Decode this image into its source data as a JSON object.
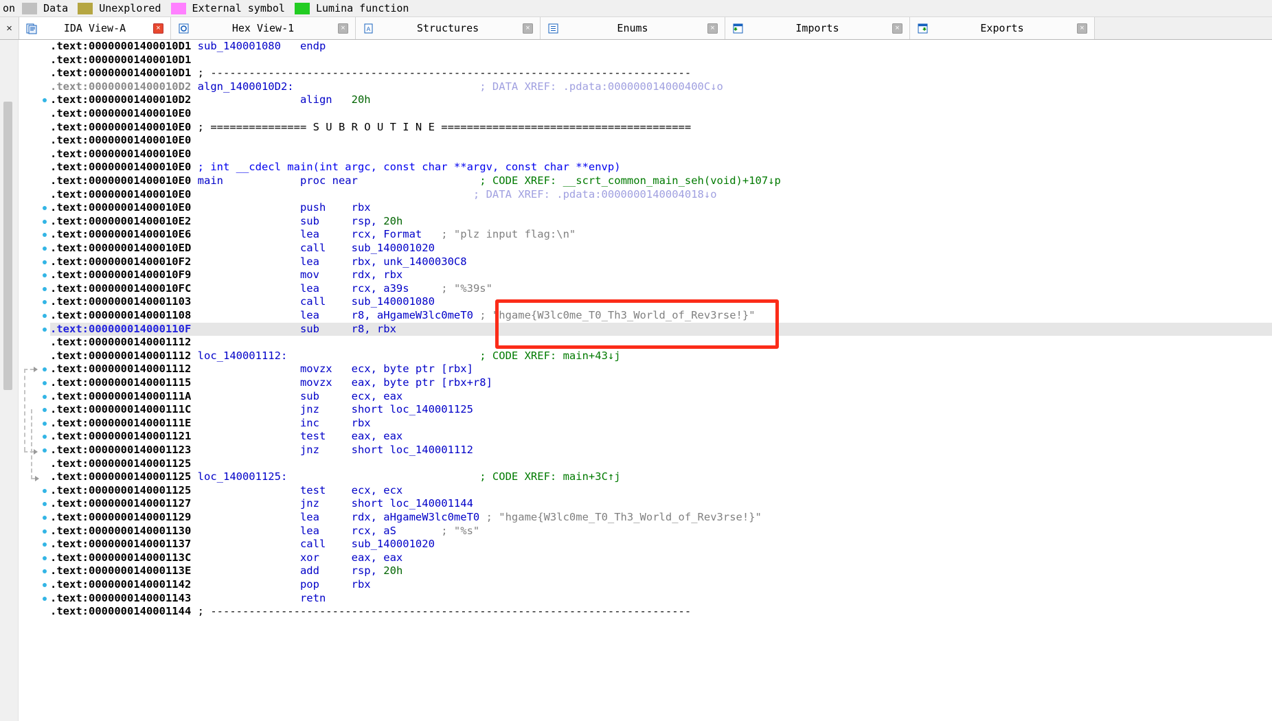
{
  "legend": {
    "leading_text": "on",
    "items": [
      {
        "label": "Data",
        "color": "#c0c0c0"
      },
      {
        "label": "Unexplored",
        "color": "#b5a642"
      },
      {
        "label": "External symbol",
        "color": "#ff80ff"
      },
      {
        "label": "Lumina function",
        "color": "#22cc22"
      }
    ]
  },
  "tabs": {
    "close_all_label": "×",
    "items": [
      {
        "title": "IDA View-A",
        "icon": "ida-view-icon",
        "active": true,
        "close_label": "×"
      },
      {
        "title": "Hex View-1",
        "icon": "hex-view-icon",
        "active": false,
        "close_label": "×"
      },
      {
        "title": "Structures",
        "icon": "structures-icon",
        "active": false,
        "close_label": "×"
      },
      {
        "title": "Enums",
        "icon": "enums-icon",
        "active": false,
        "close_label": "×"
      },
      {
        "title": "Imports",
        "icon": "imports-icon",
        "active": false,
        "close_label": "×"
      },
      {
        "title": "Exports",
        "icon": "exports-icon",
        "active": false,
        "close_label": "×"
      }
    ]
  },
  "annotation": {
    "highlight_color": "#fb2c19",
    "highlighted_string": "\"hgame{W3lc0me_T0_Th3_World_of_Rev3rse!}\""
  },
  "disassembly": {
    "segment": ".text",
    "lines": [
      {
        "addr": ".text:00000001400010D1",
        "label": "sub_140001080",
        "mnem": "",
        "ops": "",
        "kw": "endp",
        "cmt": "",
        "dot": false
      },
      {
        "addr": ".text:00000001400010D1",
        "label": "",
        "mnem": "",
        "ops": "",
        "kw": "",
        "cmt": "",
        "dot": false
      },
      {
        "addr": ".text:00000001400010D1",
        "label": "",
        "mnem": "",
        "ops": "",
        "kw": "",
        "cmt": "",
        "dash": "; ---------------------------------------------------------------------------",
        "dot": false
      },
      {
        "addr": ".text:00000001400010D2",
        "dim": true,
        "label": "algn_1400010D2:",
        "mnem": "",
        "ops": "",
        "kw": "",
        "cmt": "; DATA XREF: .pdata:000000014000400C↓o",
        "cmt_type": "lav",
        "dot": false
      },
      {
        "addr": ".text:00000001400010D2",
        "label": "",
        "mnem": "align",
        "ops": "20h",
        "kw": "",
        "cmt": "",
        "dot": true
      },
      {
        "addr": ".text:00000001400010E0",
        "label": "",
        "mnem": "",
        "ops": "",
        "kw": "",
        "cmt": "",
        "dot": false
      },
      {
        "addr": ".text:00000001400010E0",
        "label": "",
        "mnem": "",
        "ops": "",
        "kw": "",
        "cmt": "",
        "banner": "; =============== S U B R O U T I N E =======================================",
        "dot": false
      },
      {
        "addr": ".text:00000001400010E0",
        "label": "",
        "mnem": "",
        "ops": "",
        "kw": "",
        "cmt": "",
        "dot": false
      },
      {
        "addr": ".text:00000001400010E0",
        "label": "",
        "mnem": "",
        "ops": "",
        "kw": "",
        "cmt": "",
        "dot": false
      },
      {
        "addr": ".text:00000001400010E0",
        "label": "",
        "mnem": "",
        "ops": "",
        "kw": "",
        "cmt": "",
        "bluecmt": "; int __cdecl main(int argc, const char **argv, const char **envp)",
        "dot": false
      },
      {
        "addr": ".text:00000001400010E0",
        "label": "main",
        "mnem": "",
        "ops": "",
        "kw": "proc near",
        "cmt": "; CODE XREF: __scrt_common_main_seh(void)+107↓p",
        "cmt_type": "green",
        "dot": false
      },
      {
        "addr": ".text:00000001400010E0",
        "label": "",
        "mnem": "",
        "ops": "",
        "kw": "",
        "cmt": "; DATA XREF: .pdata:0000000140004018↓o",
        "cmt_type": "lav",
        "dot": false
      },
      {
        "addr": ".text:00000001400010E0",
        "label": "",
        "mnem": "push",
        "ops": "rbx",
        "kw": "",
        "cmt": "",
        "dot": true
      },
      {
        "addr": ".text:00000001400010E2",
        "label": "",
        "mnem": "sub",
        "ops": "rsp, 20h",
        "kw": "",
        "cmt": "",
        "dot": true
      },
      {
        "addr": ".text:00000001400010E6",
        "label": "",
        "mnem": "lea",
        "ops": "rcx, Format",
        "kw": "",
        "cmt": "; \"plz input flag:\\n\"",
        "cmt_type": "gray",
        "dot": true
      },
      {
        "addr": ".text:00000001400010ED",
        "label": "",
        "mnem": "call",
        "ops": "sub_140001020",
        "kw": "",
        "cmt": "",
        "dot": true
      },
      {
        "addr": ".text:00000001400010F2",
        "label": "",
        "mnem": "lea",
        "ops": "rbx, unk_1400030C8",
        "kw": "",
        "cmt": "",
        "dot": true
      },
      {
        "addr": ".text:00000001400010F9",
        "label": "",
        "mnem": "mov",
        "ops": "rdx, rbx",
        "kw": "",
        "cmt": "",
        "dot": true
      },
      {
        "addr": ".text:00000001400010FC",
        "label": "",
        "mnem": "lea",
        "ops": "rcx, a39s",
        "kw": "",
        "cmt": "; \"%39s\"",
        "cmt_type": "gray",
        "dot": true
      },
      {
        "addr": ".text:0000000140001103",
        "label": "",
        "mnem": "call",
        "ops": "sub_140001080",
        "kw": "",
        "cmt": "",
        "dot": true
      },
      {
        "addr": ".text:0000000140001108",
        "label": "",
        "mnem": "lea",
        "ops": "r8, aHgameW3lc0meT0",
        "kw": "",
        "cmt": "; \"hgame{W3lc0me_T0_Th3_World_of_Rev3rse!}\"",
        "cmt_type": "gray",
        "dot": true
      },
      {
        "addr": ".text:000000014000110F",
        "label": "",
        "mnem": "sub",
        "ops": "r8, rbx",
        "kw": "",
        "cmt": "",
        "dot": true,
        "selected": true
      },
      {
        "addr": ".text:0000000140001112",
        "label": "",
        "mnem": "",
        "ops": "",
        "kw": "",
        "cmt": "",
        "dot": false
      },
      {
        "addr": ".text:0000000140001112",
        "label": "loc_140001112:",
        "mnem": "",
        "ops": "",
        "kw": "",
        "cmt": "; CODE XREF: main+43↓j",
        "cmt_type": "green",
        "dot": false
      },
      {
        "addr": ".text:0000000140001112",
        "label": "",
        "mnem": "movzx",
        "ops": "ecx, byte ptr [rbx]",
        "kw": "",
        "cmt": "",
        "dot": true
      },
      {
        "addr": ".text:0000000140001115",
        "label": "",
        "mnem": "movzx",
        "ops": "eax, byte ptr [rbx+r8]",
        "kw": "",
        "cmt": "",
        "dot": true
      },
      {
        "addr": ".text:000000014000111A",
        "label": "",
        "mnem": "sub",
        "ops": "ecx, eax",
        "kw": "",
        "cmt": "",
        "dot": true
      },
      {
        "addr": ".text:000000014000111C",
        "label": "",
        "mnem": "jnz",
        "ops": "short loc_140001125",
        "kw": "",
        "cmt": "",
        "dot": true
      },
      {
        "addr": ".text:000000014000111E",
        "label": "",
        "mnem": "inc",
        "ops": "rbx",
        "kw": "",
        "cmt": "",
        "dot": true
      },
      {
        "addr": ".text:0000000140001121",
        "label": "",
        "mnem": "test",
        "ops": "eax, eax",
        "kw": "",
        "cmt": "",
        "dot": true
      },
      {
        "addr": ".text:0000000140001123",
        "label": "",
        "mnem": "jnz",
        "ops": "short loc_140001112",
        "kw": "",
        "cmt": "",
        "dot": true
      },
      {
        "addr": ".text:0000000140001125",
        "label": "",
        "mnem": "",
        "ops": "",
        "kw": "",
        "cmt": "",
        "dot": false
      },
      {
        "addr": ".text:0000000140001125",
        "label": "loc_140001125:",
        "mnem": "",
        "ops": "",
        "kw": "",
        "cmt": "; CODE XREF: main+3C↑j",
        "cmt_type": "green",
        "dot": false
      },
      {
        "addr": ".text:0000000140001125",
        "label": "",
        "mnem": "test",
        "ops": "ecx, ecx",
        "kw": "",
        "cmt": "",
        "dot": true
      },
      {
        "addr": ".text:0000000140001127",
        "label": "",
        "mnem": "jnz",
        "ops": "short loc_140001144",
        "kw": "",
        "cmt": "",
        "dot": true
      },
      {
        "addr": ".text:0000000140001129",
        "label": "",
        "mnem": "lea",
        "ops": "rdx, aHgameW3lc0meT0",
        "kw": "",
        "cmt": "; \"hgame{W3lc0me_T0_Th3_World_of_Rev3rse!}\"",
        "cmt_type": "gray",
        "dot": true
      },
      {
        "addr": ".text:0000000140001130",
        "label": "",
        "mnem": "lea",
        "ops": "rcx, aS",
        "kw": "",
        "cmt": "; \"%s\"",
        "cmt_type": "gray",
        "dot": true
      },
      {
        "addr": ".text:0000000140001137",
        "label": "",
        "mnem": "call",
        "ops": "sub_140001020",
        "kw": "",
        "cmt": "",
        "dot": true
      },
      {
        "addr": ".text:000000014000113C",
        "label": "",
        "mnem": "xor",
        "ops": "eax, eax",
        "kw": "",
        "cmt": "",
        "dot": true
      },
      {
        "addr": ".text:000000014000113E",
        "label": "",
        "mnem": "add",
        "ops": "rsp, 20h",
        "kw": "",
        "cmt": "",
        "dot": true
      },
      {
        "addr": ".text:0000000140001142",
        "label": "",
        "mnem": "pop",
        "ops": "rbx",
        "kw": "",
        "cmt": "",
        "dot": true
      },
      {
        "addr": ".text:0000000140001143",
        "label": "",
        "mnem": "retn",
        "ops": "",
        "kw": "",
        "cmt": "",
        "dot": true
      },
      {
        "addr": ".text:0000000140001144",
        "label": "",
        "mnem": "",
        "ops": "",
        "kw": "",
        "cmt": "",
        "dash": "; ---------------------------------------------------------------------------",
        "dot": false
      }
    ]
  }
}
